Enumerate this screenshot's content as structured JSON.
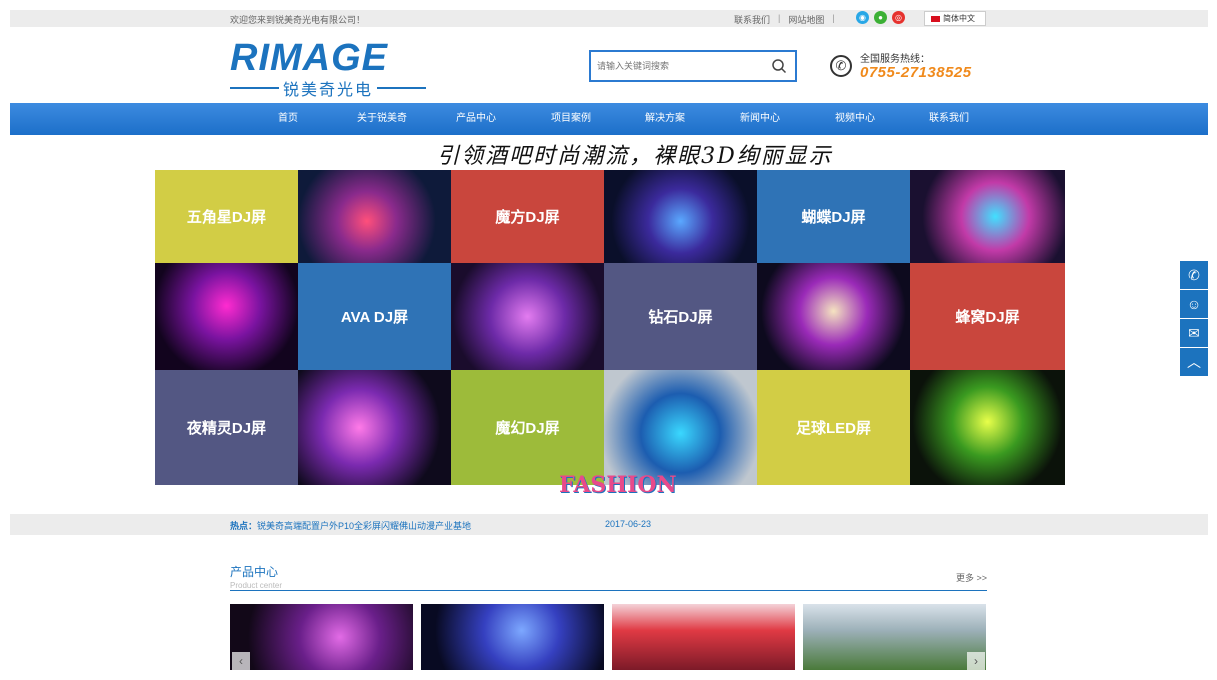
{
  "topbar": {
    "welcome": "欢迎您来到锐美奇光电有限公司！",
    "links": [
      "联系我们",
      "网站地图"
    ],
    "separator": "|",
    "social_icons": [
      "qq-icon",
      "wechat-icon",
      "weibo-icon"
    ],
    "language": "简体中文"
  },
  "header": {
    "logo_en": "RIMAGE",
    "logo_cn": "锐美奇光电",
    "search_placeholder": "请输入关键词搜索",
    "hotline_label": "全国服务热线：",
    "hotline_number": "0755-27138525"
  },
  "nav": {
    "items": [
      "首页",
      "关于锐美奇",
      "产品中心",
      "项目案例",
      "解决方案",
      "新闻中心",
      "视频中心",
      "联系我们"
    ]
  },
  "banner": {
    "slogan": "引领酒吧时尚潮流，裸眼3D绚丽显示",
    "tiles": {
      "t1": "五角星DJ屏",
      "t2": "魔方DJ屏",
      "t3": "蝴蝶DJ屏",
      "t4": "AVA DJ屏",
      "t5": "钻石DJ屏",
      "t6": "蜂窝DJ屏",
      "t7": "夜精灵DJ屏",
      "t8": "魔幻DJ屏",
      "t9": "足球LED屏"
    },
    "fashion_text": "FASHION"
  },
  "ticker": {
    "hot_label": "热点：",
    "headline": "锐美奇高端配置户外P10全彩屏闪耀佛山动漫产业基地",
    "date": "2017-06-23"
  },
  "products": {
    "title_cn": "产品中心",
    "title_en": "Product center",
    "more": "更多 >>",
    "prev": "‹",
    "next": "›"
  },
  "colors": {
    "brand_blue": "#1c73be",
    "hotline_orange": "#f08a1c",
    "tile_yellow": "#d2cd45",
    "tile_red": "#c9463d",
    "tile_blue": "#2f73b6",
    "tile_purple": "#535783",
    "tile_green": "#9dbb3a"
  }
}
